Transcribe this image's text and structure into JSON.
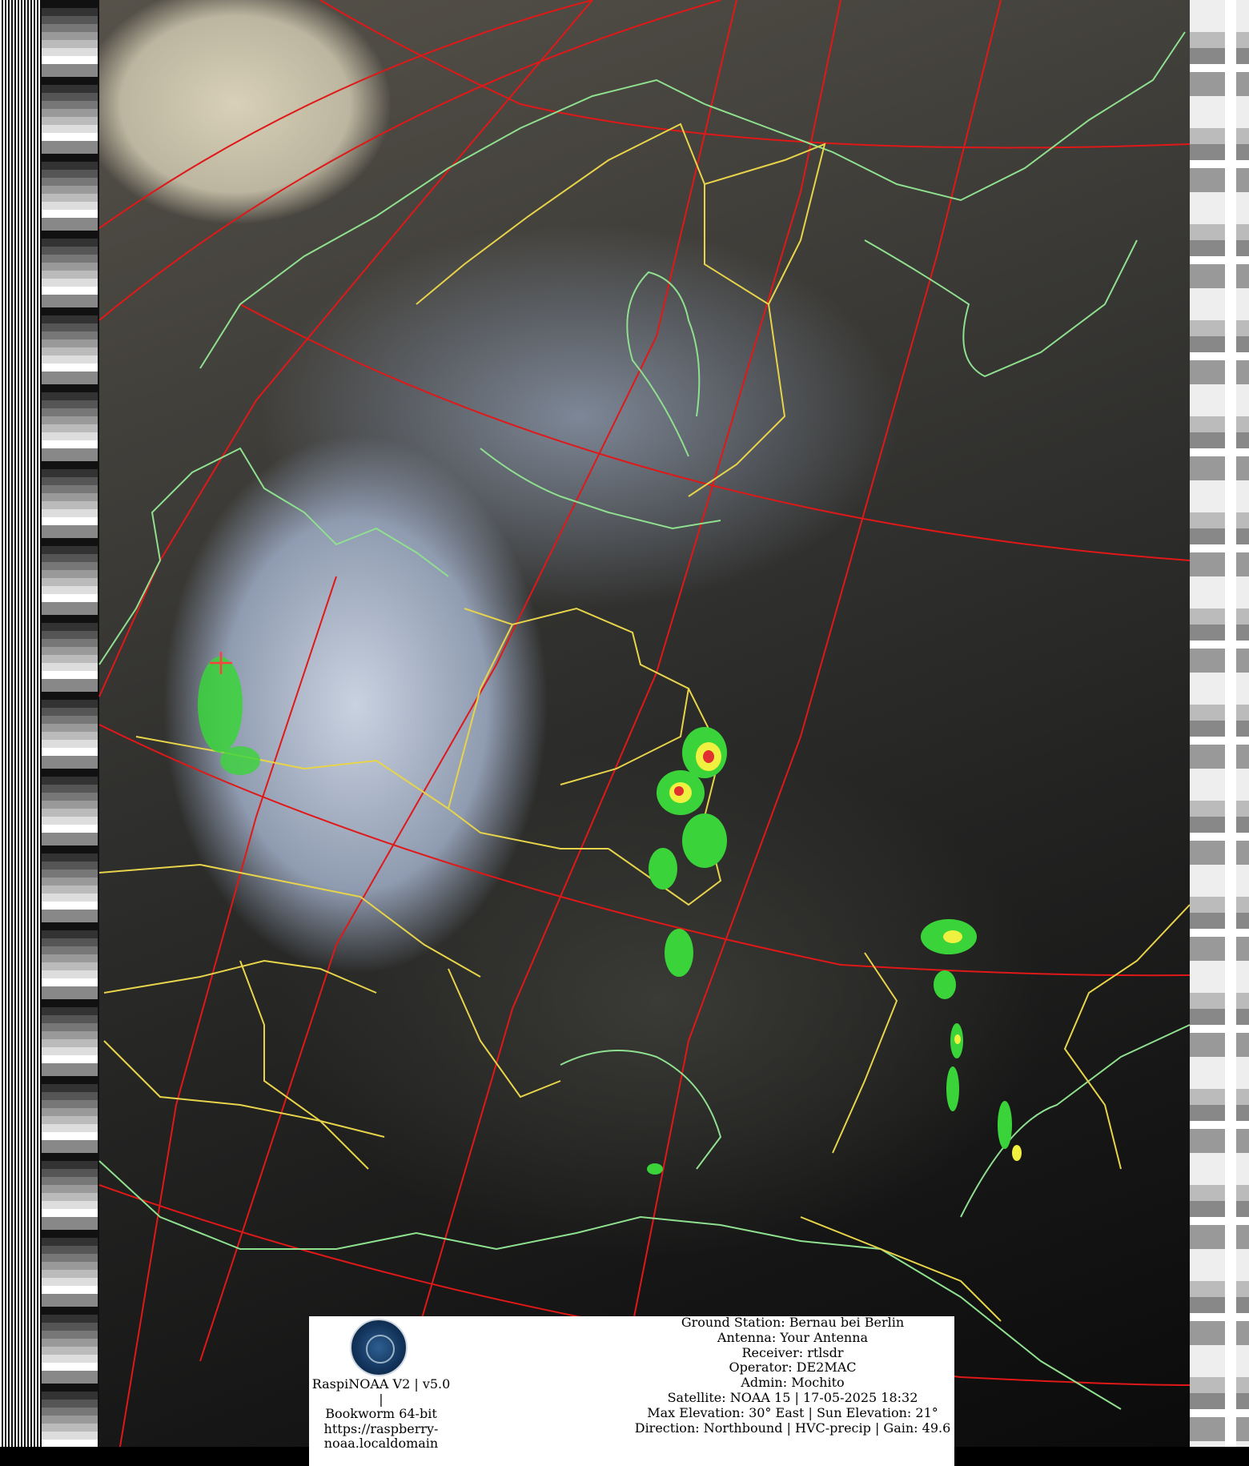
{
  "image": {
    "description_hidden": "",
    "colors": {
      "grid": "#e01818",
      "coast": "#8fe08f",
      "borders": "#e8d44a",
      "precip_green": "#3ad43a",
      "precip_yellow": "#f0f040",
      "precip_red": "#e03030"
    }
  },
  "footer": {
    "left_lines": [
      "RaspiNOAA V2 | v5.0 |",
      "Bookworm 64-bit",
      "https://raspberry-",
      "noaa.localdomain"
    ],
    "right_lines": [
      "Ground Station: Bernau bei Berlin",
      "Antenna: Your Antenna",
      "Receiver: rtlsdr",
      "Operator: DE2MAC",
      "Admin: Mochito",
      "Satellite: NOAA 15 | 17-05-2025 18:32",
      "Max Elevation: 30° East | Sun Elevation: 21°",
      "Direction: Northbound | HVC-precip | Gain: 49.6"
    ]
  }
}
